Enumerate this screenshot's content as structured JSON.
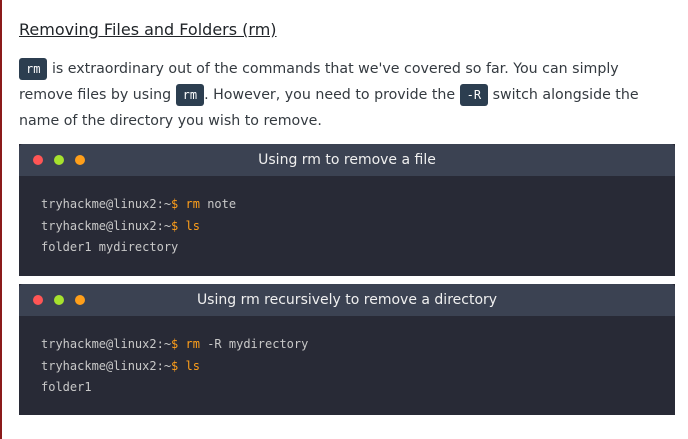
{
  "section": {
    "title": "Removing Files and Folders (rm)",
    "para_cmd1": "rm",
    "para_text1": " is extraordinary out of the commands that we've covered so far. You can simply remove files by using ",
    "para_cmd2": "rm",
    "para_text2": ". However, you need to provide the ",
    "para_cmd3": "-R",
    "para_text3": " switch alongside the name of the directory you wish to remove."
  },
  "terminals": [
    {
      "title": "Using rm to remove a file",
      "lines": [
        {
          "prompt": "tryhackme@linux2:~",
          "dollar": "$",
          "cmd": "rm",
          "args": "note"
        },
        {
          "prompt": "tryhackme@linux2:~",
          "dollar": "$",
          "cmd": "ls",
          "args": ""
        },
        {
          "output": "folder1 mydirectory"
        }
      ]
    },
    {
      "title": "Using rm recursively to remove a directory",
      "lines": [
        {
          "prompt": "tryhackme@linux2:~",
          "dollar": "$",
          "cmd": "rm",
          "args": "-R mydirectory"
        },
        {
          "prompt": "tryhackme@linux2:~",
          "dollar": "$",
          "cmd": "ls",
          "args": ""
        },
        {
          "output": "folder1"
        }
      ]
    }
  ],
  "colors": {
    "accent_orange": "#ff9f1a",
    "terminal_bg": "#282a36",
    "terminal_bar": "#3b4252",
    "code_pill_bg": "#2c3e50"
  }
}
